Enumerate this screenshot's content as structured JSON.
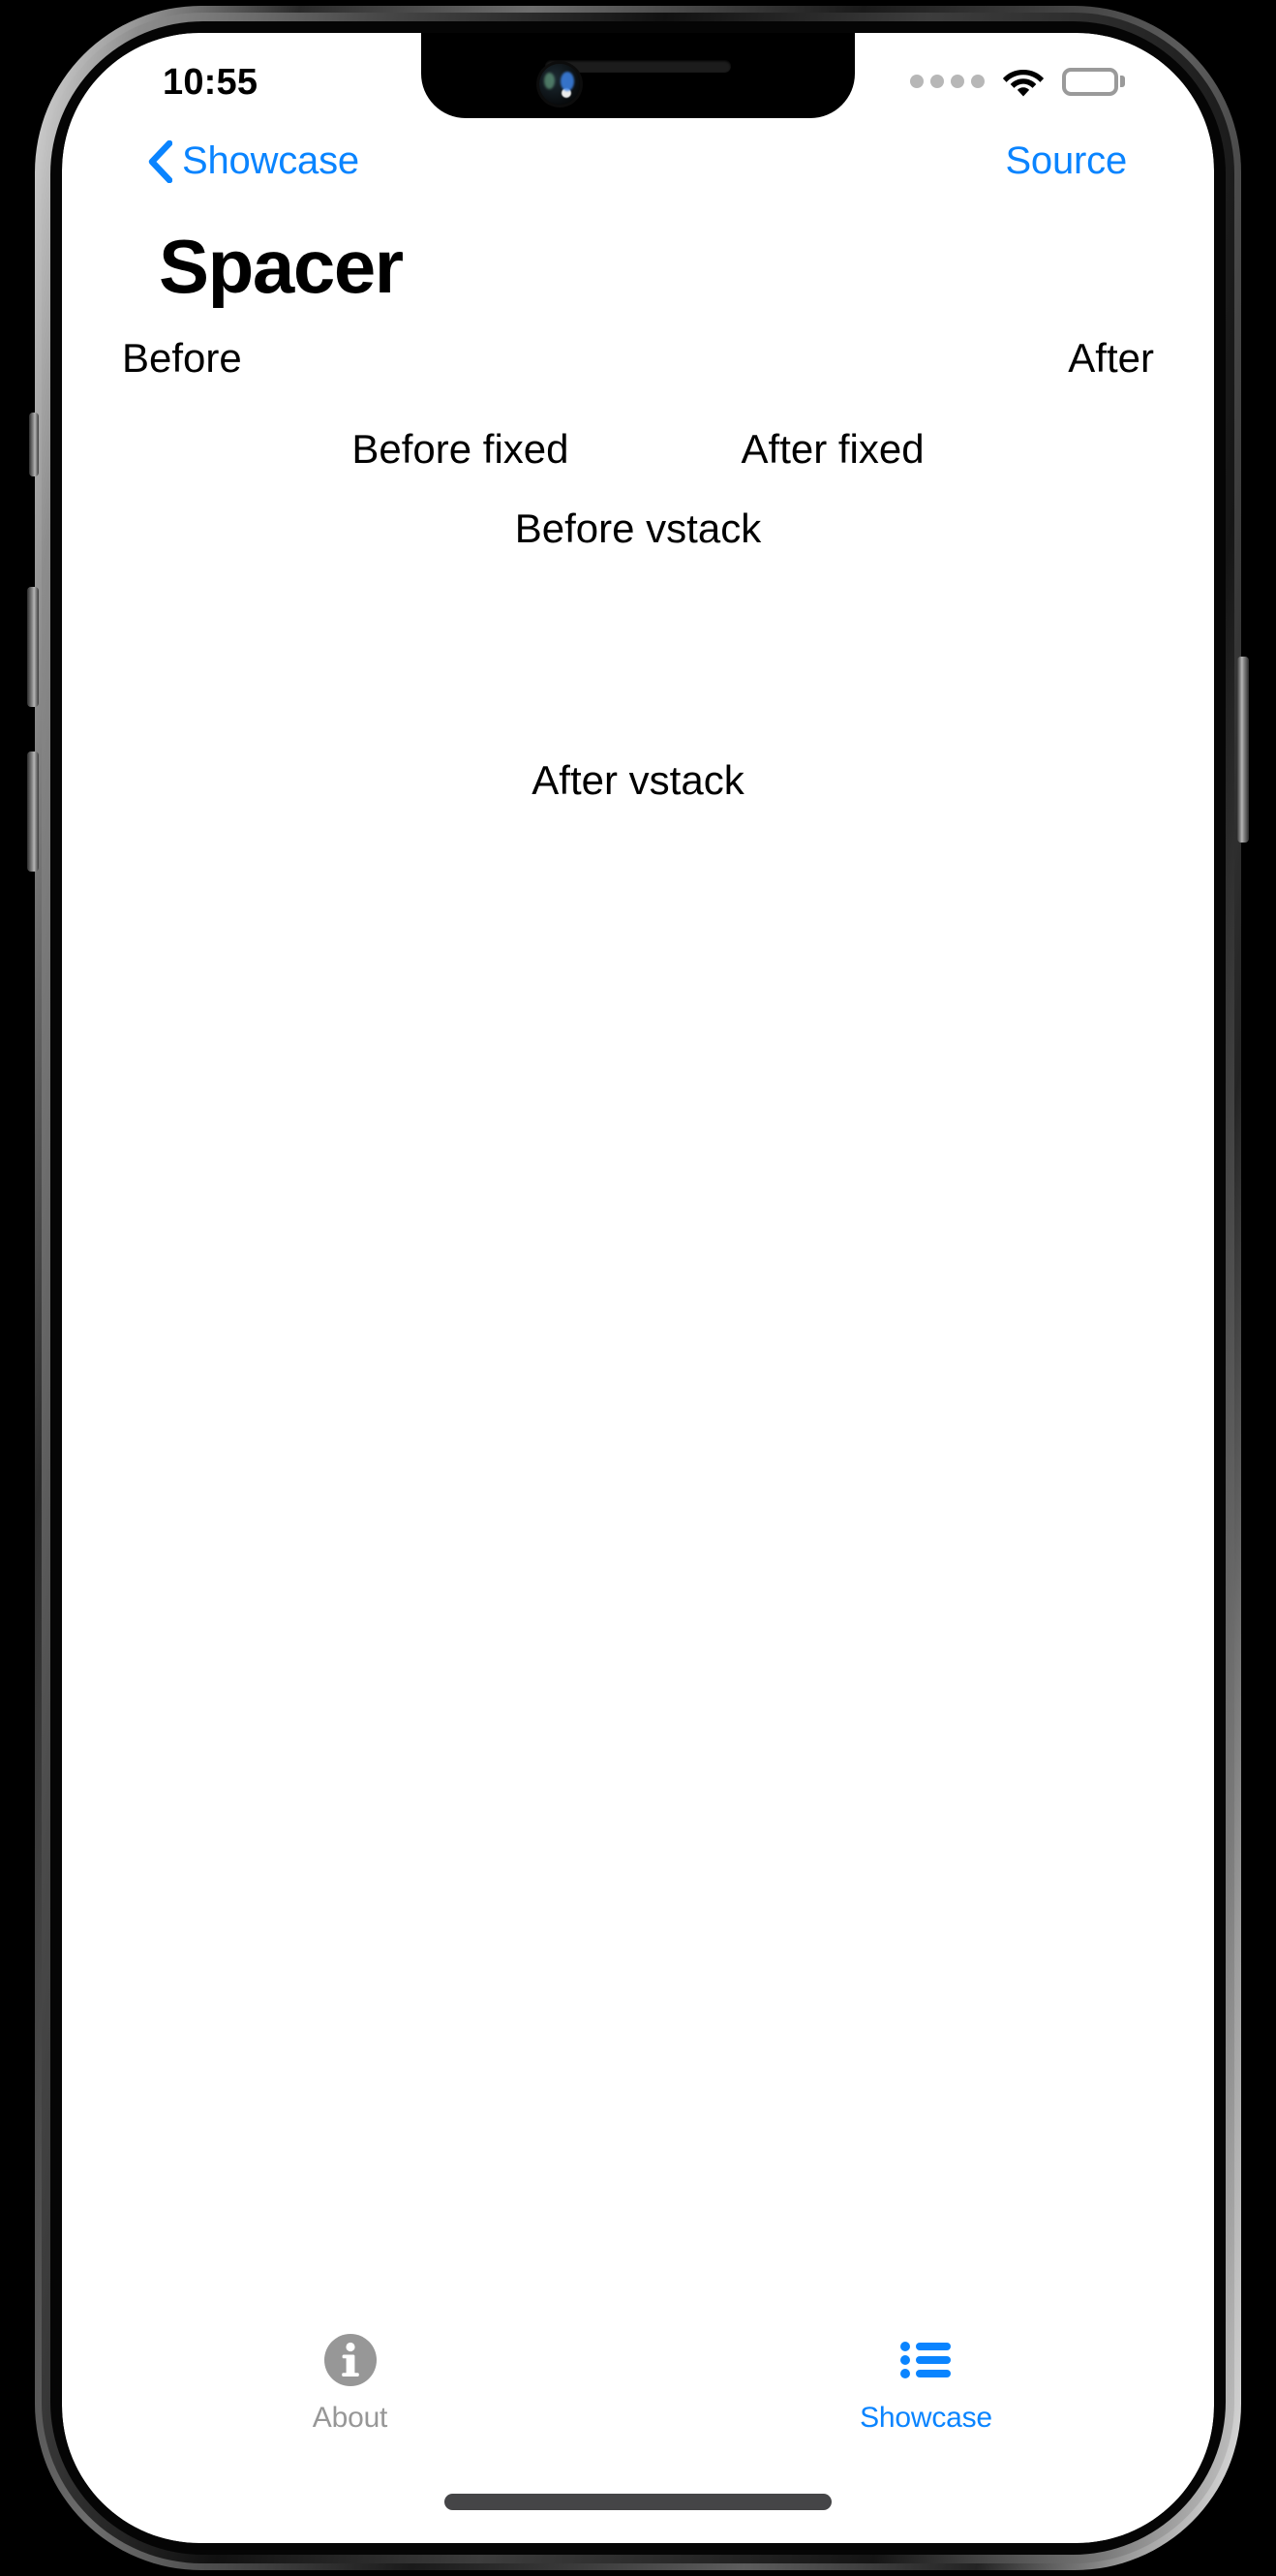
{
  "status_bar": {
    "time": "10:55",
    "cellular_icon": "cellular-dots-icon",
    "cellular_dots": 4,
    "wifi_icon": "wifi-icon",
    "battery_icon": "battery-full-icon"
  },
  "nav_bar": {
    "back_icon": "chevron-left-icon",
    "back_label": "Showcase",
    "source_label": "Source"
  },
  "page": {
    "title": "Spacer"
  },
  "demo": {
    "hstack": {
      "leading_label": "Before",
      "trailing_label": "After"
    },
    "fixed": {
      "leading_label": "Before fixed",
      "trailing_label": "After fixed"
    },
    "vstack": {
      "top_label": "Before vstack",
      "bottom_label": "After vstack"
    }
  },
  "tab_bar": {
    "tabs": [
      {
        "id": "about",
        "label": "About",
        "icon": "info-circle-icon",
        "active": false
      },
      {
        "id": "showcase",
        "label": "Showcase",
        "icon": "list-bullet-icon",
        "active": true
      }
    ]
  },
  "colors": {
    "accent": "#0a84ff",
    "inactive": "#979797",
    "text": "#000000",
    "background": "#ffffff"
  }
}
